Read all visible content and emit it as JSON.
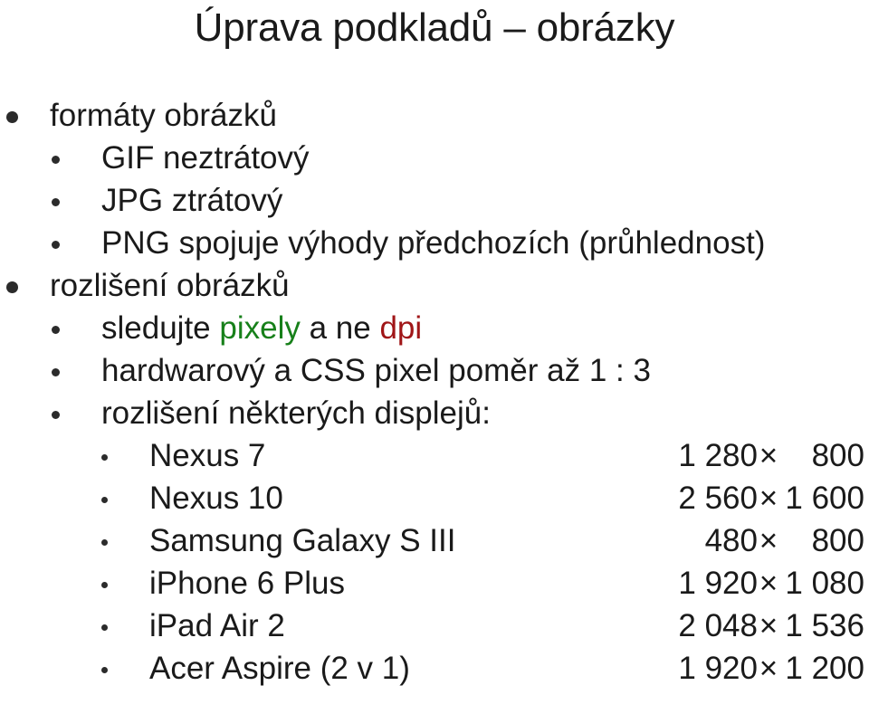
{
  "slide": {
    "title": "Úprava podkladů – obrázky",
    "background_color": "#ffffff",
    "text_color": "#1a1a1a",
    "accent_green": "#17801a",
    "accent_red": "#a01517",
    "bullet_glyph": "filled-circle",
    "outline": [
      {
        "level": 1,
        "text": "formáty obrázků"
      },
      {
        "level": 2,
        "text": "GIF neztrátový"
      },
      {
        "level": 2,
        "text": "JPG ztrátový"
      },
      {
        "level": 2,
        "text": "PNG spojuje výhody předchozích (průhlednost)"
      },
      {
        "level": 1,
        "text": "rozlišení obrázků"
      },
      {
        "level": 2,
        "text": "sledujte pixely a ne dpi",
        "segments": [
          {
            "text": "sledujte ",
            "color": "default"
          },
          {
            "text": "pixely",
            "color": "green"
          },
          {
            "text": " a ne ",
            "color": "default"
          },
          {
            "text": "dpi",
            "color": "red"
          }
        ]
      },
      {
        "level": 2,
        "text": "hardwarový a CSS pixel poměr až 1 : 3"
      },
      {
        "level": 2,
        "text": "rozlišení některých displejů:"
      }
    ],
    "devices": [
      {
        "name": "Nexus 7",
        "width": "1 280",
        "sep": "×",
        "height": "800"
      },
      {
        "name": "Nexus 10",
        "width": "2 560",
        "sep": "×",
        "height": "1 600"
      },
      {
        "name": "Samsung Galaxy S III",
        "width": "480",
        "sep": "×",
        "height": "800"
      },
      {
        "name": "iPhone 6 Plus",
        "width": "1 920",
        "sep": "×",
        "height": "1 080"
      },
      {
        "name": "iPad Air 2",
        "width": "2 048",
        "sep": "×",
        "height": "1 536"
      },
      {
        "name": "Acer Aspire (2 v 1)",
        "width": "1 920",
        "sep": "×",
        "height": "1 200"
      }
    ]
  }
}
